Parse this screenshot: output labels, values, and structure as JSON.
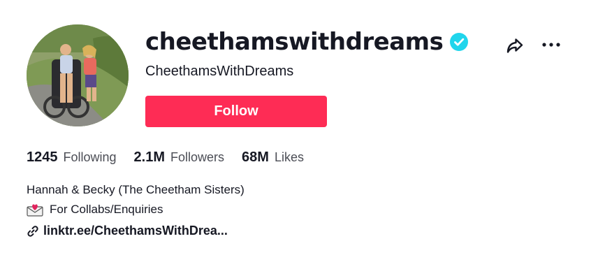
{
  "profile": {
    "username": "cheethamswithdreams",
    "nickname": "CheethamsWithDreams",
    "verified": true
  },
  "actions": {
    "follow_label": "Follow"
  },
  "stats": [
    {
      "value": "1245",
      "label": "Following"
    },
    {
      "value": "2.1M",
      "label": "Followers"
    },
    {
      "value": "68M",
      "label": "Likes"
    }
  ],
  "bio": {
    "line1": "Hannah & Becky (The Cheetham Sisters)",
    "line2": "For Collabs/Enquiries",
    "line2_icon": "envelope-heart-icon"
  },
  "link": {
    "text": "linktr.ee/CheethamsWithDrea..."
  },
  "colors": {
    "follow_button": "#fe2c55",
    "verified_badge": "#20d5ec",
    "text": "#161823",
    "secondary_text": "#4b4d55"
  }
}
